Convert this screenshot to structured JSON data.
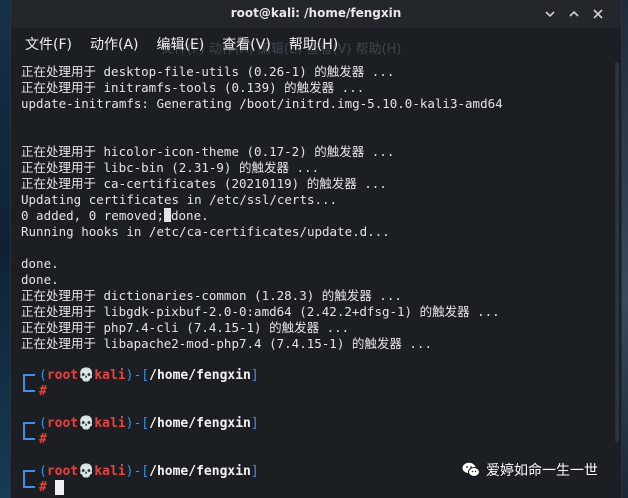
{
  "window": {
    "title": "root@kali: /home/fengxin"
  },
  "menu": {
    "items": [
      "文件(F)",
      "动作(A)",
      "编辑(E)",
      "查看(V)",
      "帮助(H)"
    ],
    "ghost_text": "文件(F)  动作(A)  编辑(E)  查看(V)  帮助(H)"
  },
  "terminal": {
    "lines": [
      "正在处理用于 desktop-file-utils (0.26-1) 的触发器 ...",
      "正在处理用于 initramfs-tools (0.139) 的触发器 ...",
      "update-initramfs: Generating /boot/initrd.img-5.10.0-kali3-amd64",
      "",
      "",
      "正在处理用于 hicolor-icon-theme (0.17-2) 的触发器 ...",
      "正在处理用于 libc-bin (2.31-9) 的触发器 ...",
      "正在处理用于 ca-certificates (20210119) 的触发器 ...",
      "Updating certificates in /etc/ssl/certs...",
      "0 added, 0 removed;",
      "Running hooks in /etc/ca-certificates/update.d...",
      "",
      "done.",
      "done.",
      "正在处理用于 dictionaries-common (1.28.3) 的触发器 ...",
      "正在处理用于 libgdk-pixbuf-2.0-0:amd64 (2.42.2+dfsg-1) 的触发器 ...",
      "正在处理用于 php7.4-cli (7.4.15-1) 的触发器 ...",
      "正在处理用于 libapache2-mod-php7.4 (7.4.15-1) 的触发器 ..."
    ],
    "removed_done_suffix": "done.",
    "prompt": {
      "open": "(",
      "user_host": "root💀kali",
      "sep": ")-[",
      "dir": "/home/fengxin",
      "close": "]",
      "hash": "#"
    }
  },
  "colors": {
    "background": "#1b1e23",
    "text": "#e4e4e4",
    "prompt_blue": "#3f8fe8",
    "prompt_red": "#e8413a"
  },
  "watermark": {
    "text": "爱婷如命一生一世",
    "icon": "wechat-icon"
  }
}
